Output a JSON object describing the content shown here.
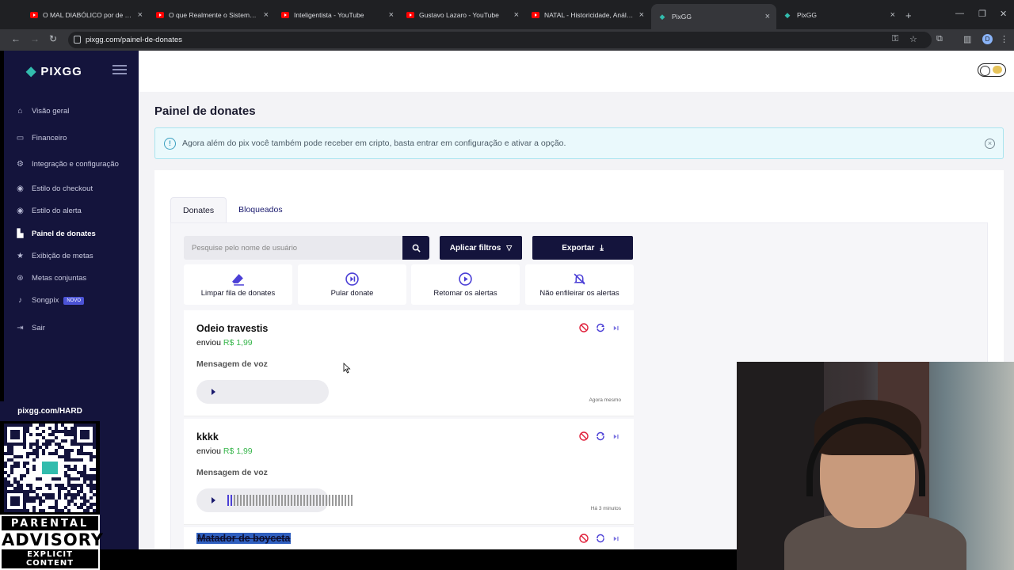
{
  "browser": {
    "tabs": [
      {
        "title": "O MAL DIABÓLICO por de TRÁS",
        "icon": "youtube-icon"
      },
      {
        "title": "O que Realmente o Sistema qu",
        "icon": "youtube-icon"
      },
      {
        "title": "Inteligentista - YouTube",
        "icon": "youtube-icon"
      },
      {
        "title": "Gustavo Lazaro - YouTube",
        "icon": "youtube-icon"
      },
      {
        "title": "NATAL - Historicidade, Análise",
        "icon": "youtube-icon"
      },
      {
        "title": "PixGG",
        "icon": "pixgg-icon"
      },
      {
        "title": "PixGG",
        "icon": "pixgg-icon"
      }
    ],
    "url": "pixgg.com/painel-de-donates",
    "profile_initial": "D"
  },
  "sidebar": {
    "brand": "PIXGG",
    "items": [
      {
        "label": "Visão geral",
        "icon": "home-icon"
      },
      {
        "label": "Financeiro",
        "icon": "wallet-icon"
      },
      {
        "label": "Integração e configuração",
        "icon": "settings-icon"
      },
      {
        "label": "Estilo do checkout",
        "icon": "palette-icon"
      },
      {
        "label": "Estilo do alerta",
        "icon": "palette-icon"
      },
      {
        "label": "Painel de donates",
        "icon": "chart-icon"
      },
      {
        "label": "Exibição de metas",
        "icon": "star-icon"
      },
      {
        "label": "Metas conjuntas",
        "icon": "share-icon"
      },
      {
        "label": "Songpix",
        "icon": "music-icon",
        "badge": "NOVO"
      },
      {
        "label": "Sair",
        "icon": "logout-icon"
      }
    ],
    "active": "Painel de donates"
  },
  "page": {
    "title": "Painel de donates",
    "alert": "Agora além do pix você também pode receber em cripto, basta entrar em configuração e ativar a opção.",
    "tabs": [
      "Donates",
      "Bloqueados"
    ],
    "search_placeholder": "Pesquise pelo nome de usuário",
    "filter_label": "Aplicar filtros",
    "export_label": "Exportar",
    "actions": [
      "Limpar fila de donates",
      "Pular donate",
      "Retomar os alertas",
      "Não enfileirar os alertas"
    ]
  },
  "donates": [
    {
      "name": "Odeio travestis",
      "sent": "enviou",
      "amount": "R$ 1,99",
      "message": "Mensagem de voz",
      "time": "Agora mesmo",
      "progress": 0
    },
    {
      "name": "kkkk",
      "sent": "enviou",
      "amount": "R$ 1,99",
      "message": "Mensagem de voz",
      "time": "Há 3 minutos",
      "progress": 0.05
    },
    {
      "name": "Matador de boyceta"
    }
  ],
  "overlay": {
    "qr_link": "pixgg.com/HARD",
    "advisory_line1": "PARENTAL",
    "advisory_line2": "ADVISORY",
    "advisory_line3": "EXPLICIT CONTENT"
  },
  "colors": {
    "sidebar": "#14143c",
    "accent": "#32bcad",
    "amount": "#36b54a",
    "danger": "#e0233d",
    "primary_button": "#14143c"
  }
}
